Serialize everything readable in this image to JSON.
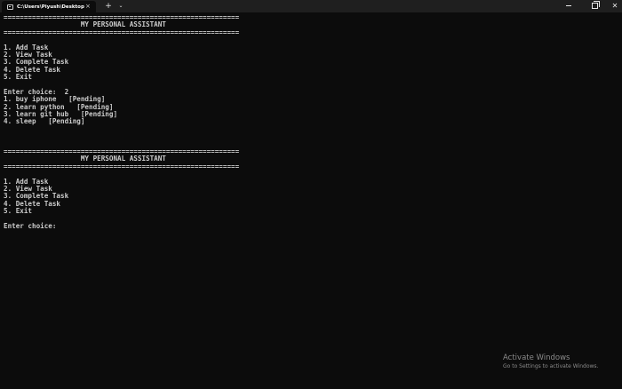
{
  "tab": {
    "icon": "terminal-icon",
    "title": "C:\\Users\\Piyush\\Desktop\\Exe",
    "close_glyph": "×"
  },
  "tabbar": {
    "new_tab_glyph": "+",
    "dropdown_glyph": "⌄"
  },
  "window_controls": {
    "close_glyph": "✕"
  },
  "console": {
    "lines": [
      "==========================================================",
      "                   MY PERSONAL ASSISTANT",
      "==========================================================",
      "",
      "1. Add Task",
      "2. View Task",
      "3. Complete Task",
      "4. Delete Task",
      "5. Exit",
      "",
      "Enter choice:  2",
      "1. buy iphone   [Pending]",
      "2. learn python   [Pending]",
      "3. learn git hub   [Pending]",
      "4. sleep   [Pending]",
      "",
      "",
      "",
      "==========================================================",
      "                   MY PERSONAL ASSISTANT",
      "==========================================================",
      "",
      "1. Add Task",
      "2. View Task",
      "3. Complete Task",
      "4. Delete Task",
      "5. Exit",
      "",
      "Enter choice:"
    ]
  },
  "watermark": {
    "title": "Activate Windows",
    "subtitle": "Go to Settings to activate Windows."
  },
  "colors": {
    "background": "#0c0c0c",
    "titlebar": "#1f1f1f",
    "text": "#cccccc",
    "watermark": "#8a8a8a"
  }
}
